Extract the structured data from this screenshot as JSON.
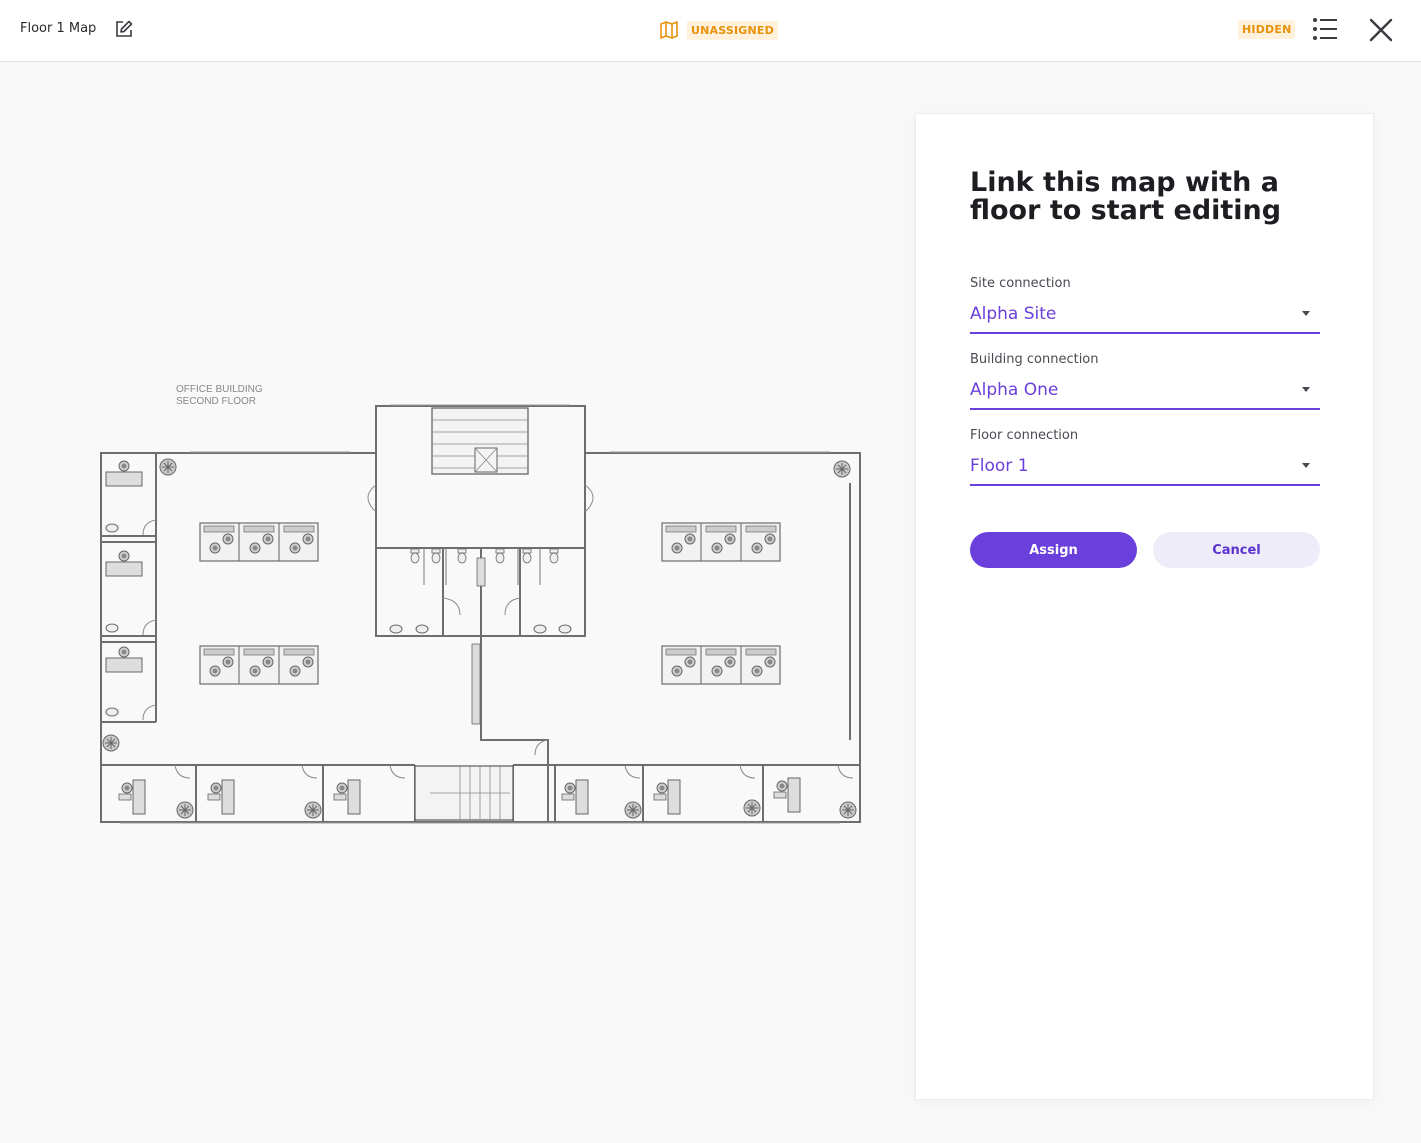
{
  "header": {
    "title": "Floor 1 Map",
    "status_label": "UNASSIGNED",
    "visibility_label": "HIDDEN"
  },
  "floorplan": {
    "label_line1": "OFFICE BUILDING",
    "label_line2": "SECOND FLOOR"
  },
  "panel": {
    "heading": "Link this map with a floor to start editing",
    "site": {
      "label": "Site connection",
      "value": "Alpha Site"
    },
    "building": {
      "label": "Building connection",
      "value": "Alpha One"
    },
    "floor": {
      "label": "Floor connection",
      "value": "Floor 1"
    },
    "assign_label": "Assign",
    "cancel_label": "Cancel"
  },
  "colors": {
    "accent": "#6a3fdc",
    "warning": "#e8920c",
    "warning_bg": "#fff1dc",
    "cancel_bg": "#efecfa"
  },
  "icons": [
    "edit-icon",
    "map-icon",
    "list-icon",
    "close-icon",
    "chevron-down-icon",
    "chair-icon",
    "plant-icon",
    "toilet-icon",
    "sink-icon"
  ]
}
